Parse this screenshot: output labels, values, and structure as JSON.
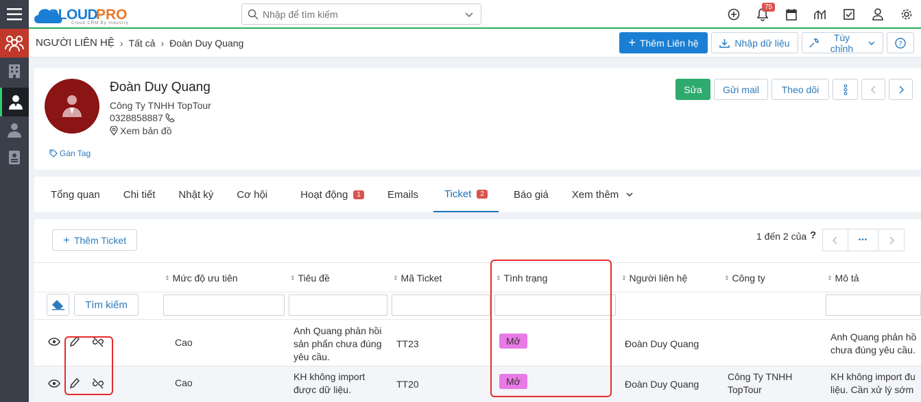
{
  "logo": {
    "text_a": "CLOUD",
    "text_b": "PRO",
    "tagline": "Cloud CRM By Industry"
  },
  "search": {
    "placeholder": "Nhập để tìm kiếm"
  },
  "notifications": {
    "count": "75"
  },
  "breadcrumb": {
    "module": "NGƯỜI LIÊN HỆ",
    "all": "Tất cả",
    "current": "Đoàn Duy Quang"
  },
  "header_actions": {
    "add_contact": "Thêm Liên hệ",
    "import": "Nhập dữ liệu",
    "customize": "Tùy chỉnh"
  },
  "contact": {
    "name": "Đoàn Duy Quang",
    "company": "Công Ty TNHH TopTour",
    "phone": "0328858887",
    "map_link": "Xem bản đồ",
    "tag_link": "Gán Tag"
  },
  "contact_actions": {
    "edit": "Sửa",
    "send_mail": "Gửi mail",
    "follow": "Theo dõi"
  },
  "tabs": [
    {
      "label": "Tổng quan"
    },
    {
      "label": "Chi tiết"
    },
    {
      "label": "Nhật ký"
    },
    {
      "label": "Cơ hội"
    },
    {
      "label": "Hoạt động",
      "badge": "1"
    },
    {
      "label": "Emails"
    },
    {
      "label": "Ticket",
      "badge": "2"
    },
    {
      "label": "Báo giá"
    },
    {
      "label": "Xem thêm"
    }
  ],
  "ticket_panel": {
    "add_button": "Thêm Ticket",
    "pagination": "1 đến 2 của",
    "pagination_help": "?",
    "pagination_more": "•••",
    "search_button": "Tìm kiếm",
    "columns": [
      "Mức độ ưu tiên",
      "Tiêu đề",
      "Mã Ticket",
      "Tình trạng",
      "Người liên hệ",
      "Công ty",
      "Mô tả"
    ],
    "rows": [
      {
        "priority": "Cao",
        "title": [
          "Anh Quang phản hồi",
          "sản phẩn chưa đúng",
          "yêu cầu."
        ],
        "code": "TT23",
        "status": "Mở",
        "contact": "Đoàn Duy Quang",
        "company": [
          "",
          ""
        ],
        "description": [
          "Anh Quang phản hồ",
          "chưa đúng yêu cầu."
        ]
      },
      {
        "priority": "Cao",
        "title": [
          "KH không import",
          "được dữ liệu."
        ],
        "code": "TT20",
        "status": "Mở",
        "contact": "Đoàn Duy Quang",
        "company": [
          "Công Ty TNHH",
          "TopTour"
        ],
        "description": [
          "KH không import đu",
          "liệu. Cần xử lý sớm"
        ]
      }
    ]
  },
  "colors": {
    "accent": "#1a7fd4",
    "success": "#2eaa6e",
    "status_open": "#e87ae6",
    "highlight": "#e52b2b",
    "avatar_bg": "#8b1414"
  }
}
